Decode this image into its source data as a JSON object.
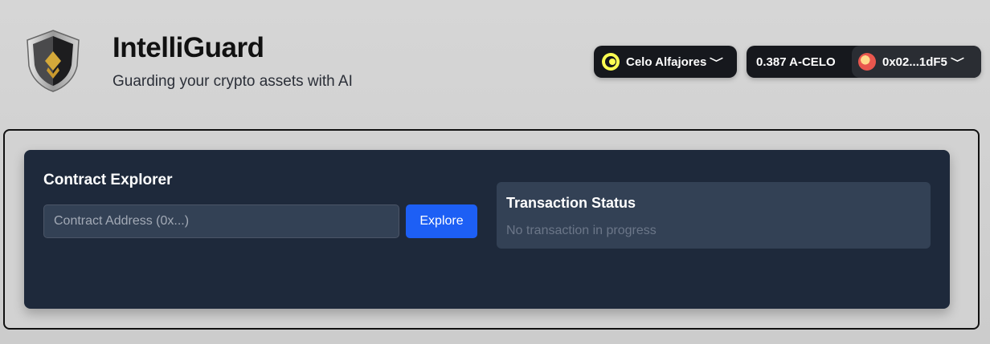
{
  "header": {
    "app_title": "IntelliGuard",
    "app_subtitle": "Guarding your crypto assets with AI",
    "logo_icon": "shield-logo-icon"
  },
  "network": {
    "name": "Celo Alfajores",
    "icon": "celo-icon",
    "chevron": "﹀"
  },
  "account": {
    "balance": "0.387 A-CELO",
    "address": "0x02...1dF5",
    "avatar_icon": "avatar-icon",
    "chevron": "﹀"
  },
  "contract_explorer": {
    "title": "Contract Explorer",
    "input_placeholder": "Contract Address (0x...)",
    "input_value": "",
    "explore_label": "Explore"
  },
  "transaction_status": {
    "title": "Transaction Status",
    "message": "No transaction in progress"
  },
  "colors": {
    "card_bg": "#1e293b",
    "panel_bg": "#334155",
    "accent": "#1d5ff5",
    "celo_yellow": "#fcff52"
  }
}
